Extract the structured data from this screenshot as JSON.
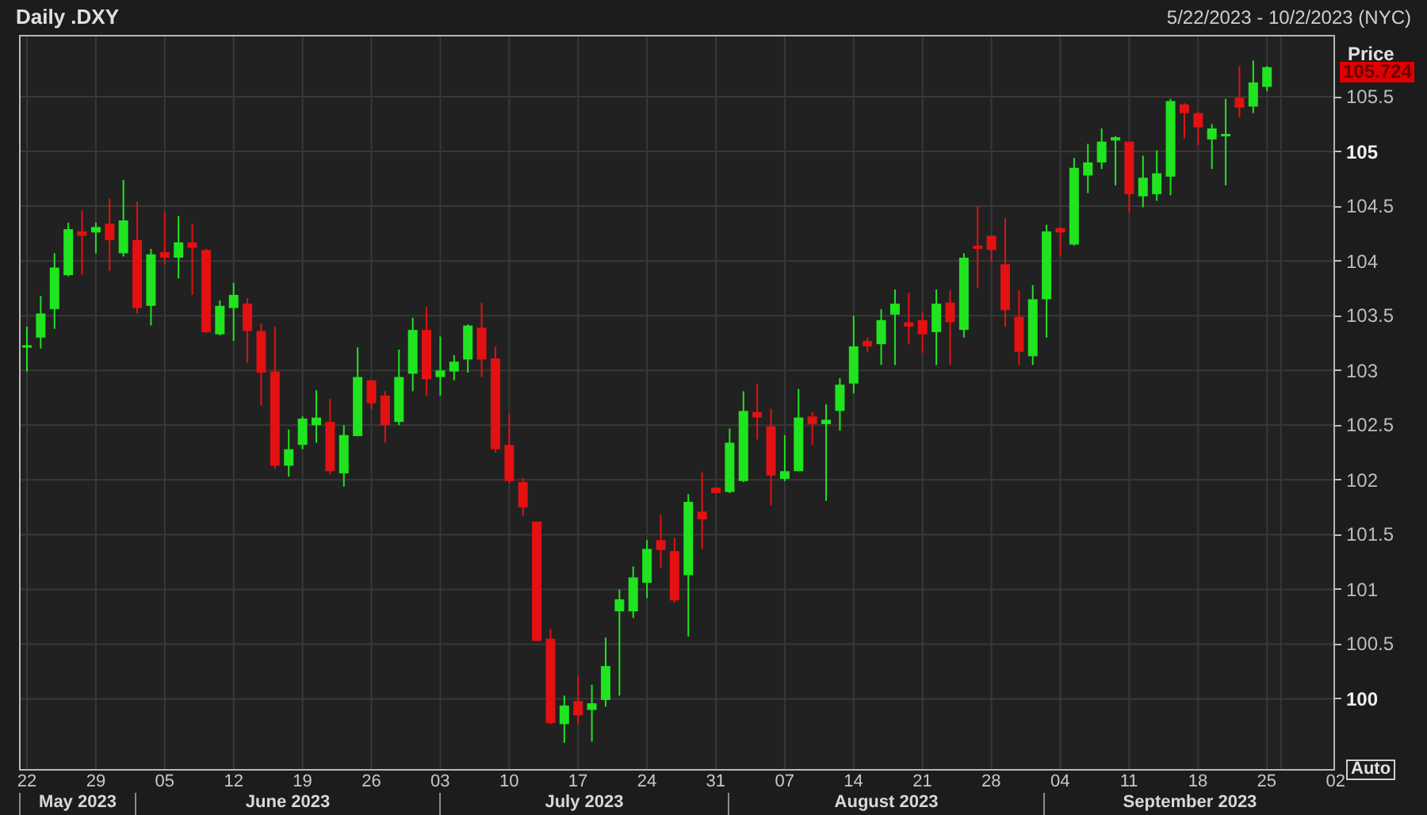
{
  "header": {
    "title": "Daily .DXY",
    "date_range": "5/22/2023 - 10/2/2023 (NYC)"
  },
  "price_axis": {
    "label": "Price",
    "current_price": "105.724",
    "ticks": [
      {
        "major": false
      },
      {
        "major": true
      },
      {
        "major": false
      },
      {
        "major": false
      },
      {
        "major": false
      },
      {
        "major": false
      },
      {
        "major": false
      },
      {
        "major": false
      },
      {
        "major": false
      },
      {
        "major": false
      },
      {
        "major": false
      },
      {
        "major": true
      }
    ],
    "auto_button": "Auto"
  },
  "chart_data": {
    "type": "candlestick",
    "categories": [
      "22",
      null,
      null,
      null,
      null,
      "29",
      null,
      null,
      null,
      null,
      "05",
      null,
      null,
      null,
      null,
      "12",
      null,
      null,
      null,
      null,
      "19",
      null,
      null,
      null,
      null,
      "26",
      null,
      null,
      null,
      null,
      "03",
      null,
      null,
      null,
      null,
      "10",
      null,
      null,
      null,
      null,
      "17",
      null,
      null,
      null,
      null,
      "24",
      null,
      null,
      null,
      null,
      "31",
      null,
      null,
      null,
      null,
      "07",
      null,
      null,
      null,
      null,
      "14",
      null,
      null,
      null,
      null,
      "21",
      null,
      null,
      null,
      null,
      "28",
      null,
      null,
      null,
      null,
      "04",
      null,
      null,
      null,
      null,
      "11",
      null,
      null,
      null,
      null,
      "18",
      null,
      null,
      null,
      null,
      "25"
    ],
    "ohlc": [
      [
        103.22,
        103.4,
        102.99,
        103.23
      ],
      [
        103.3,
        103.68,
        103.2,
        103.52
      ],
      [
        103.56,
        104.07,
        103.38,
        103.94
      ],
      [
        103.87,
        104.35,
        103.86,
        104.29
      ],
      [
        104.27,
        104.46,
        103.87,
        104.23
      ],
      [
        104.26,
        104.35,
        104.07,
        104.31
      ],
      [
        104.34,
        104.57,
        103.91,
        104.19
      ],
      [
        104.07,
        104.74,
        104.04,
        104.37
      ],
      [
        104.19,
        104.54,
        103.52,
        103.57
      ],
      [
        103.59,
        104.11,
        103.41,
        104.06
      ],
      [
        104.08,
        104.45,
        103.97,
        104.03
      ],
      [
        104.03,
        104.41,
        103.84,
        104.17
      ],
      [
        104.17,
        104.34,
        103.69,
        104.12
      ],
      [
        104.1,
        104.11,
        103.34,
        103.35
      ],
      [
        103.33,
        103.64,
        103.32,
        103.59
      ],
      [
        103.57,
        103.8,
        103.27,
        103.69
      ],
      [
        103.61,
        103.66,
        103.07,
        103.36
      ],
      [
        103.36,
        103.43,
        102.68,
        102.98
      ],
      [
        102.99,
        103.4,
        102.1,
        102.13
      ],
      [
        102.13,
        102.46,
        102.03,
        102.28
      ],
      [
        102.32,
        102.58,
        102.28,
        102.56
      ],
      [
        102.5,
        102.82,
        102.34,
        102.57
      ],
      [
        102.53,
        102.74,
        102.05,
        102.08
      ],
      [
        102.06,
        102.5,
        101.94,
        102.41
      ],
      [
        102.4,
        103.21,
        102.4,
        102.94
      ],
      [
        102.91,
        102.91,
        102.64,
        102.7
      ],
      [
        102.77,
        102.81,
        102.34,
        102.5
      ],
      [
        102.53,
        103.19,
        102.5,
        102.94
      ],
      [
        102.97,
        103.48,
        102.81,
        103.37
      ],
      [
        103.37,
        103.58,
        102.77,
        102.92
      ],
      [
        102.94,
        103.31,
        102.77,
        103.0
      ],
      [
        102.99,
        103.14,
        102.91,
        103.08
      ],
      [
        103.1,
        103.42,
        102.98,
        103.41
      ],
      [
        103.39,
        103.62,
        102.94,
        103.1
      ],
      [
        103.11,
        103.22,
        102.25,
        102.28
      ],
      [
        102.32,
        102.6,
        101.97,
        101.99
      ],
      [
        101.98,
        102.02,
        101.67,
        101.75
      ],
      [
        101.62,
        101.62,
        100.53,
        100.53
      ],
      [
        100.55,
        100.64,
        99.77,
        99.78
      ],
      [
        99.77,
        100.03,
        99.6,
        99.94
      ],
      [
        99.98,
        100.21,
        99.77,
        99.85
      ],
      [
        99.9,
        100.13,
        99.61,
        99.96
      ],
      [
        99.99,
        100.56,
        99.93,
        100.3
      ],
      [
        100.8,
        101.0,
        100.03,
        100.91
      ],
      [
        100.8,
        101.21,
        100.74,
        101.11
      ],
      [
        101.06,
        101.45,
        100.92,
        101.37
      ],
      [
        101.45,
        101.68,
        101.2,
        101.36
      ],
      [
        101.35,
        101.47,
        100.88,
        100.9
      ],
      [
        101.13,
        101.87,
        100.57,
        101.8
      ],
      [
        101.71,
        102.07,
        101.37,
        101.64
      ],
      [
        101.93,
        101.93,
        101.88,
        101.88
      ],
      [
        101.89,
        102.47,
        101.88,
        102.34
      ],
      [
        101.99,
        102.81,
        101.98,
        102.63
      ],
      [
        102.62,
        102.88,
        102.37,
        102.57
      ],
      [
        102.49,
        102.65,
        101.77,
        102.04
      ],
      [
        102.01,
        102.41,
        101.99,
        102.08
      ],
      [
        102.08,
        102.83,
        102.08,
        102.57
      ],
      [
        102.58,
        102.62,
        102.32,
        102.51
      ],
      [
        102.51,
        102.69,
        101.81,
        102.55
      ],
      [
        102.63,
        102.93,
        102.45,
        102.87
      ],
      [
        102.88,
        103.5,
        102.79,
        103.22
      ],
      [
        103.27,
        103.3,
        103.17,
        103.22
      ],
      [
        103.24,
        103.56,
        103.05,
        103.46
      ],
      [
        103.51,
        103.74,
        103.05,
        103.61
      ],
      [
        103.44,
        103.71,
        103.24,
        103.4
      ],
      [
        103.46,
        103.53,
        103.16,
        103.33
      ],
      [
        103.35,
        103.74,
        103.05,
        103.61
      ],
      [
        103.62,
        103.73,
        103.05,
        103.44
      ],
      [
        103.37,
        104.07,
        103.3,
        104.03
      ],
      [
        104.14,
        104.5,
        103.75,
        104.11
      ],
      [
        104.23,
        104.23,
        103.99,
        104.1
      ],
      [
        103.97,
        104.39,
        103.4,
        103.55
      ],
      [
        103.49,
        103.73,
        103.05,
        103.17
      ],
      [
        103.13,
        103.78,
        103.05,
        103.65
      ],
      [
        103.65,
        104.33,
        103.3,
        104.27
      ],
      [
        104.3,
        104.31,
        104.05,
        104.26
      ],
      [
        104.15,
        104.94,
        104.14,
        104.85
      ],
      [
        104.78,
        105.07,
        104.62,
        104.9
      ],
      [
        104.9,
        105.21,
        104.84,
        105.09
      ],
      [
        105.1,
        105.14,
        104.69,
        105.13
      ],
      [
        105.09,
        105.09,
        104.44,
        104.61
      ],
      [
        104.59,
        104.96,
        104.49,
        104.76
      ],
      [
        104.61,
        105.01,
        104.55,
        104.8
      ],
      [
        104.77,
        105.48,
        104.6,
        105.46
      ],
      [
        105.43,
        105.44,
        105.12,
        105.35
      ],
      [
        105.35,
        105.36,
        105.06,
        105.22
      ],
      [
        105.11,
        105.25,
        104.84,
        105.21
      ],
      [
        105.14,
        105.48,
        104.69,
        105.16
      ],
      [
        105.49,
        105.78,
        105.31,
        105.4
      ],
      [
        105.41,
        105.83,
        105.35,
        105.63
      ],
      [
        105.59,
        105.78,
        105.55,
        105.77
      ]
    ],
    "ylim": [
      99.36,
      106.05
    ],
    "grid": true,
    "yticks": [
      {
        "value": 105.5,
        "label": "105.5"
      },
      {
        "value": 105,
        "label": "105"
      },
      {
        "value": 104.5,
        "label": "104.5"
      },
      {
        "value": 104,
        "label": "104"
      },
      {
        "value": 103.5,
        "label": "103.5"
      },
      {
        "value": 103,
        "label": "103"
      },
      {
        "value": 102.5,
        "label": "102.5"
      },
      {
        "value": 102,
        "label": "102"
      },
      {
        "value": 101.5,
        "label": "101.5"
      },
      {
        "value": 101,
        "label": "101"
      },
      {
        "value": 100.5,
        "label": "100.5"
      },
      {
        "value": 100,
        "label": "100"
      }
    ]
  },
  "time_axis": {
    "next_day": "02",
    "months": [
      "May 2023",
      "June 2023",
      "July 2023",
      "August 2023",
      "September 2023"
    ]
  }
}
